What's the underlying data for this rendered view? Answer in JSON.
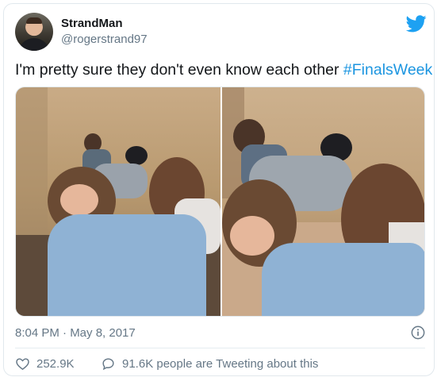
{
  "author": {
    "display_name": "StrandMan",
    "handle": "@rogerstrand97"
  },
  "tweet": {
    "text": "I'm pretty sure they don't even know each other ",
    "hashtag": "#FinalsWeek",
    "timestamp": "8:04 PM · May 8, 2017"
  },
  "actions": {
    "likes": "252.9K",
    "conversation": "91.6K people are Tweeting about this"
  },
  "icons": {
    "logo": "twitter-bird-icon",
    "info": "info-icon",
    "like": "heart-icon",
    "reply": "speech-bubble-icon"
  },
  "colors": {
    "brand": "#1da1f2",
    "hashtag": "#1b95e0",
    "secondary_text": "#657786",
    "border": "#e1e8ed"
  }
}
